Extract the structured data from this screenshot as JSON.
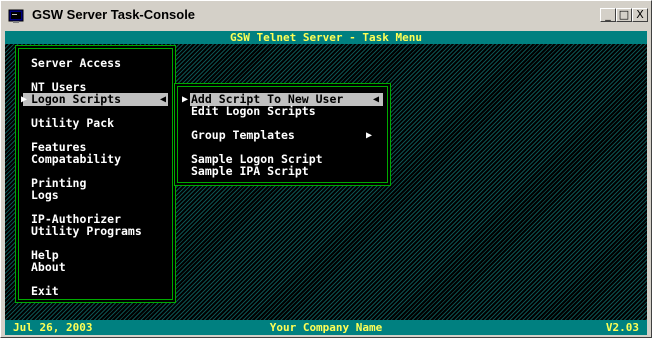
{
  "window": {
    "title": "GSW Server Task-Console",
    "buttons": {
      "minimize": "_",
      "maximize": "□",
      "close": "X"
    }
  },
  "console": {
    "header": "GSW Telnet Server - Task Menu",
    "footer": {
      "date": "Jul 26, 2003",
      "company": "Your Company Name",
      "version": "V2.03"
    }
  },
  "main_menu": {
    "items": [
      "Server Access",
      "NT Users",
      "Logon Scripts",
      "Utility Pack",
      "Features",
      "Compatability",
      "Printing",
      "Logs",
      "IP-Authorizer",
      "Utility Programs",
      "Help",
      "About",
      "Exit"
    ],
    "selected": "Logon Scripts"
  },
  "submenu": {
    "items": [
      "Add Script To New User",
      "Edit Logon Scripts",
      "Group Templates",
      "Sample Logon Script",
      "Sample IPA Script"
    ],
    "selected": "Add Script To New User"
  },
  "colors": {
    "header_bg": "#008080",
    "header_text": "#ffff55",
    "menu_border": "#00aa00",
    "highlight": "#c0c0c0"
  }
}
